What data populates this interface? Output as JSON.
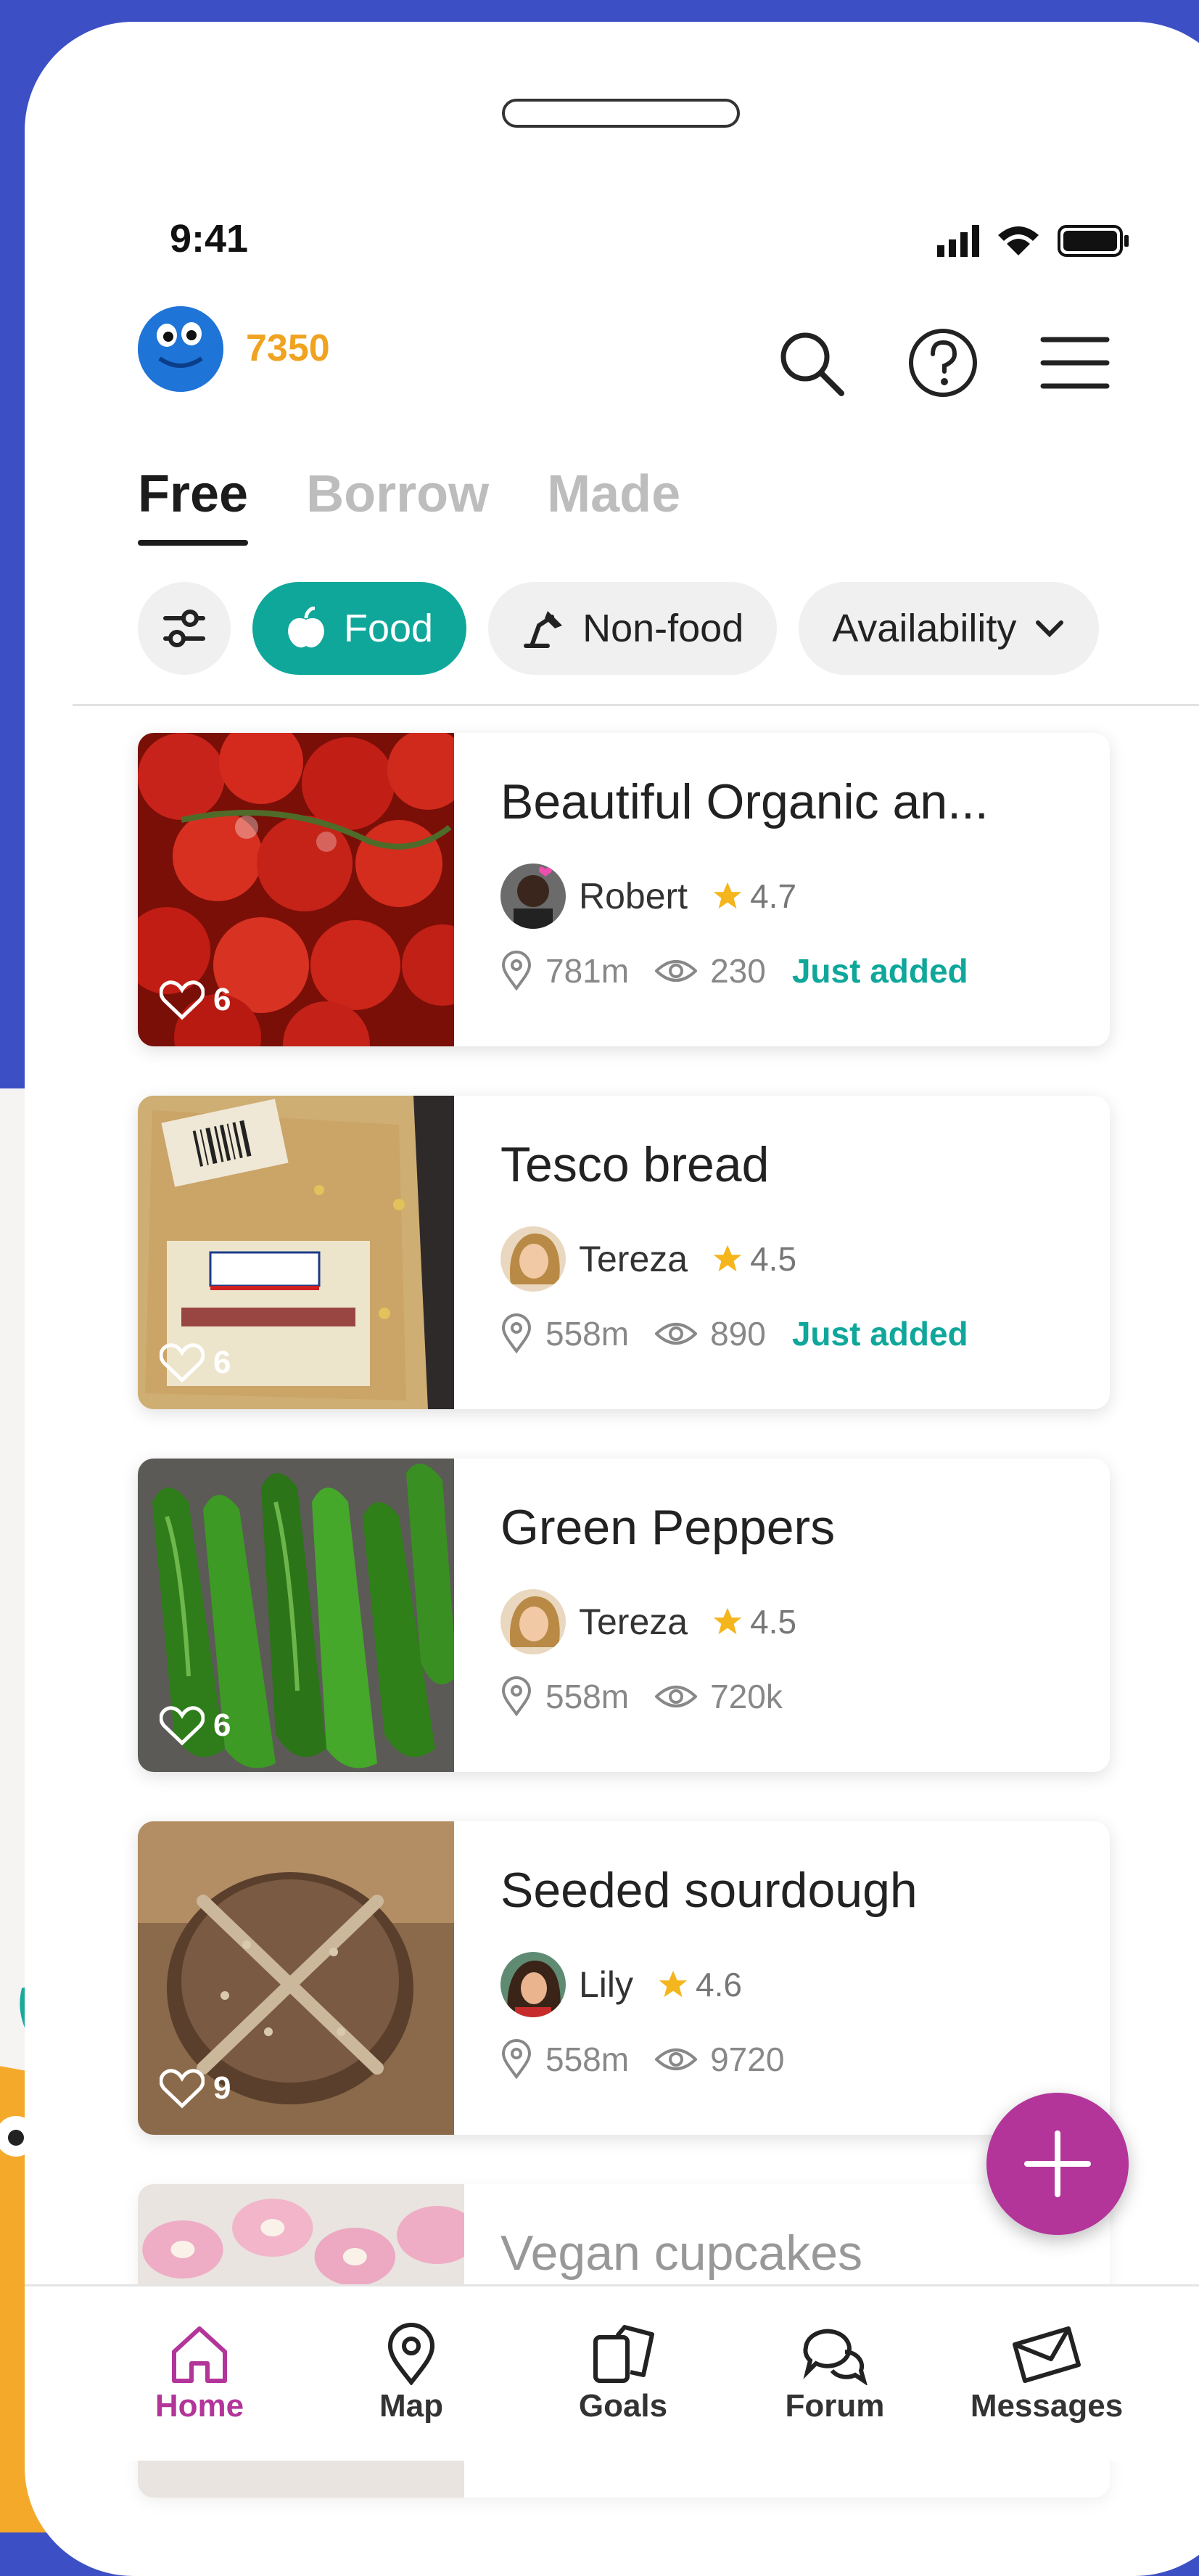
{
  "status_bar": {
    "time": "9:41"
  },
  "header": {
    "points": "7350",
    "icons": [
      "search-icon",
      "help-icon",
      "menu-icon"
    ]
  },
  "tabs": [
    {
      "label": "Free",
      "active": true
    },
    {
      "label": "Borrow",
      "active": false
    },
    {
      "label": "Made",
      "active": false
    }
  ],
  "filters": {
    "settings_icon": "sliders-icon",
    "chips": [
      {
        "label": "Food",
        "icon": "apple-icon",
        "active": true
      },
      {
        "label": "Non-food",
        "icon": "lamp-icon",
        "active": false
      },
      {
        "label": "Availability",
        "icon": "chevron-down-icon",
        "active": false
      }
    ]
  },
  "listings": [
    {
      "title": "Beautiful Organic an...",
      "user": "Robert",
      "rating": "4.7",
      "distance": "781m",
      "views": "230",
      "status": "Just added",
      "likes": "6"
    },
    {
      "title": "Tesco bread",
      "user": "Tereza",
      "rating": "4.5",
      "distance": "558m",
      "views": "890",
      "status": "Just added",
      "likes": "6"
    },
    {
      "title": "Green Peppers",
      "user": "Tereza",
      "rating": "4.5",
      "distance": "558m",
      "views": "720k",
      "status": "",
      "likes": "6"
    },
    {
      "title": "Seeded sourdough",
      "user": "Lily",
      "rating": "4.6",
      "distance": "558m",
      "views": "9720",
      "status": "",
      "likes": "9"
    },
    {
      "title": "Vegan cupcakes"
    }
  ],
  "fab": {
    "icon": "plus-icon"
  },
  "bottom_nav": [
    {
      "label": "Home",
      "icon": "home-icon",
      "active": true
    },
    {
      "label": "Map",
      "icon": "map-pin-icon",
      "active": false
    },
    {
      "label": "Goals",
      "icon": "goals-icon",
      "active": false
    },
    {
      "label": "Forum",
      "icon": "forum-icon",
      "active": false
    },
    {
      "label": "Messages",
      "icon": "envelope-icon",
      "active": false
    }
  ],
  "colors": {
    "accent": "#10a79b",
    "points": "#f0a320",
    "brand": "#b3359a",
    "background": "#3d4fc4"
  }
}
